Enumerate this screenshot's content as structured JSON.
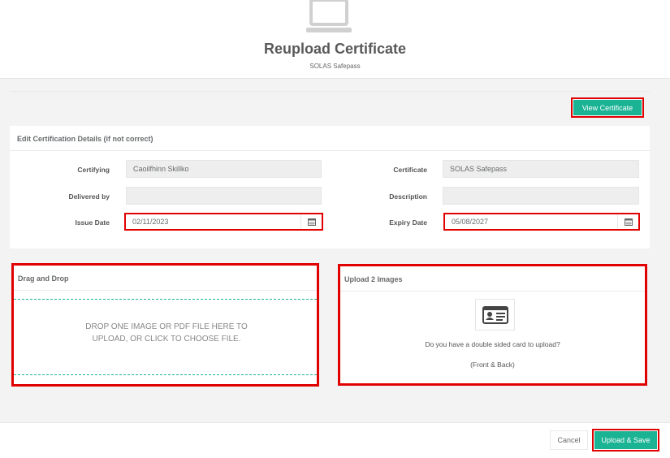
{
  "header": {
    "icon": "laptop-icon",
    "title": "Reupload Certificate",
    "subtitle": "SOLAS Safepass"
  },
  "toolbar": {
    "view_certificate_label": "View Certificate"
  },
  "edit_section": {
    "title": "Edit Certification Details (if not correct)",
    "fields": {
      "certifying": {
        "label": "Certifying",
        "value": "Caoilfhinn Skillko"
      },
      "certificate": {
        "label": "Certificate",
        "value": "SOLAS Safepass"
      },
      "delivered_by": {
        "label": "Delivered by",
        "value": ""
      },
      "description": {
        "label": "Description",
        "value": ""
      },
      "issue_date": {
        "label": "Issue Date",
        "value": "02/11/2023",
        "icon": "calendar-icon"
      },
      "expiry_date": {
        "label": "Expiry Date",
        "value": "05/08/2027",
        "icon": "calendar-icon"
      }
    }
  },
  "drag_drop": {
    "title": "Drag and Drop",
    "dropzone_text": "DROP ONE IMAGE OR PDF FILE HERE TO UPLOAD, OR CLICK TO CHOOSE FILE."
  },
  "upload_images": {
    "title": "Upload 2 Images",
    "icon": "id-card-icon",
    "question": "Do you have a double sided card to upload?",
    "note": "(Front & Back)"
  },
  "footer": {
    "cancel_label": "Cancel",
    "save_label": "Upload & Save"
  },
  "colors": {
    "accent": "#1ab394",
    "highlight": "#e00000",
    "body_bg": "#f3f3f4"
  }
}
